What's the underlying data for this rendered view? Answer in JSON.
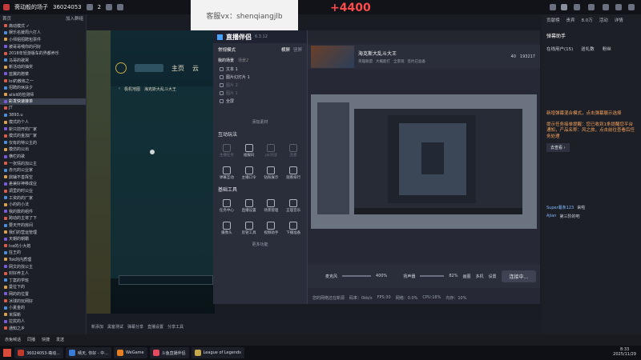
{
  "topbar": {
    "title": "斋动般的场子",
    "room_id": "36024053",
    "count": "2",
    "watermark": "客服vx：shenqiangjlb",
    "big_number": "+4400"
  },
  "left": {
    "header_a": "首页",
    "header_b": "加入群组",
    "items": [
      "斋动模式 ✓",
      "娱乐名媛周六打人",
      "小师姐招聘包票件",
      "被哥哥喂你的问好",
      "2018年轻游版车的界都养乐",
      "马哥的歌哭",
      "新活动的抽奖",
      "蓝翼的赠菜",
      "lol的教练之一",
      "招聘的休扶夕",
      "alisli的检测师",
      "彩发快速接单",
      "JT",
      "3893.u",
      "模式的个人",
      "斩只前开的厂家",
      "模式的金加厂家",
      "仅有的特公主的",
      "模仿的公出",
      "横栏的歌",
      "一张情的加公主",
      "赤元的公业家",
      "鼎辅不善挥空",
      "差兼好神移成业",
      "调里的时公业",
      "工资的的厂家",
      "小的的小法",
      "我的数的组件",
      "跨动的主将了下",
      "要天开的房间",
      "我们的营运管理",
      "天朝的朝霸",
      "Ice的小大炮",
      "狂王的",
      "Tok的内质理",
      "网文的找公主",
      "封好养主人",
      "丁案的学班",
      "曼位下的",
      "网的的位置",
      "冰球的玩网好",
      "小夏金的",
      "米探新",
      "拉扰的人",
      "通知之乡"
    ]
  },
  "stream": {
    "nav_home": "主页",
    "nav_cloud": "云",
    "map_label": "极机地图",
    "game_title": "海克斯大乱斗大王"
  },
  "companion": {
    "brand": "直播伴侣",
    "version": "6.3.12",
    "mode_label": "常规模式",
    "mode_a": "横屏",
    "mode_b": "竖屏",
    "scene_title": "我的场景",
    "scene_tab_b": "场景2",
    "scenes": [
      {
        "label": "文本 1",
        "dim": false
      },
      {
        "label": "图片幻灯片 1",
        "dim": false
      },
      {
        "label": "图片 2",
        "dim": true
      },
      {
        "label": "图片 1",
        "dim": true
      },
      {
        "label": "全屏",
        "dim": false
      }
    ],
    "add_material": "添加素材",
    "interact_title": "互动玩法",
    "interact": [
      {
        "label": "主播任务",
        "dim": true
      },
      {
        "label": "福报码",
        "dim": false
      },
      {
        "label": "pk对战",
        "dim": true
      },
      {
        "label": "连麦",
        "dim": true
      },
      {
        "label": "弹幕互动",
        "dim": false
      },
      {
        "label": "主播口令",
        "dim": false
      },
      {
        "label": "钻粉展示",
        "dim": false
      },
      {
        "label": "观看排行",
        "dim": false
      }
    ],
    "tools_title": "基础工具",
    "tools": [
      {
        "label": "任务中心",
        "dim": false
      },
      {
        "label": "直播设置",
        "dim": false
      },
      {
        "label": "场景管理",
        "dim": false
      },
      {
        "label": "正理音乐",
        "dim": false
      },
      {
        "label": "摄像头",
        "dim": false
      },
      {
        "label": "房管工具",
        "dim": false
      },
      {
        "label": "视频助手",
        "dim": false
      },
      {
        "label": "下播准备",
        "dim": false
      }
    ],
    "more": "更多功能"
  },
  "main": {
    "live_title": "海克斯大乱斗大王",
    "tag_a": "英雄联盟",
    "tag_b": "大概能打",
    "settings_a": "全景观",
    "settings_b": "签约已准备",
    "preview_count": "40",
    "likes": "193217",
    "volume_label": "麦克风",
    "volume": "400%",
    "volume2_label": "扬声器",
    "volume2": "82%",
    "tools": [
      "画图",
      "多机",
      "设置"
    ],
    "start": "连接中...",
    "status": [
      "您的网络还在新源",
      "码率：0kb/s",
      "FPS:30",
      "网络：0.0%",
      "CPU:18%",
      "内存：10%"
    ]
  },
  "rightpanel": {
    "tabs": [
      "贡献榜",
      "贵宾",
      "8.0万",
      "活动",
      "详情"
    ],
    "section": "弹幕助手",
    "online": "在线用户(15)",
    "gifts": "送礼数",
    "fans": "粉丝",
    "note1": "新增弹幕混合模式，点击弹幕展示选择",
    "note2": "提示任务接单提醒：您已收到1条提醒您平台通知，产品名称：风之旅，点击前往查看后任务处理",
    "note2_link": "去查看 ›",
    "chat": [
      {
        "user": "Super薯条123",
        "msg": "来啦"
      },
      {
        "user": "Ajian",
        "msg": "第三阶的吧"
      }
    ]
  },
  "bottom": {
    "items": [
      "新添加",
      "黑客测试",
      "弹幕分享",
      "直播设置",
      "分享工具"
    ],
    "actions": [
      "赤兔喊话",
      "同播",
      "快捷",
      "发送"
    ]
  },
  "taskbar": {
    "apps": [
      "36024053-斋动...",
      "晴天, 你好 - 中...",
      "WeGame",
      "斗鱼直播伴侣",
      "League of Legends"
    ],
    "time": "8:33",
    "date": "2025/11/29"
  }
}
